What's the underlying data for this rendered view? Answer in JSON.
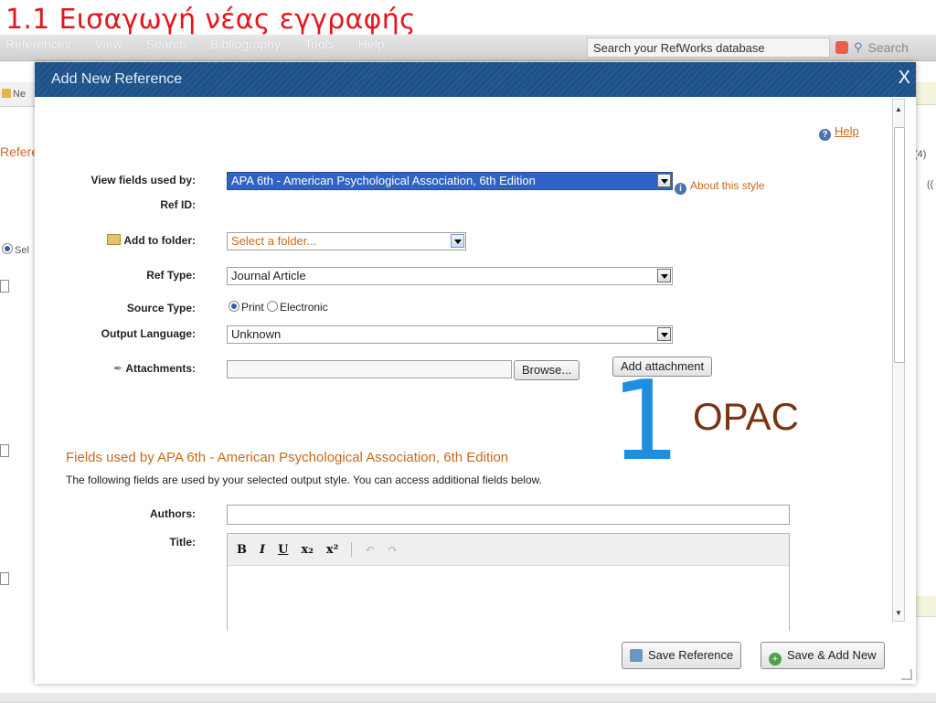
{
  "slide": {
    "title": "1.1 Εισαγωγή νέας εγγραφής"
  },
  "app": {
    "menu": [
      "References",
      "View",
      "Search",
      "Bibliography",
      "Tools",
      "Help"
    ],
    "search_placeholder": "Search your RefWorks database",
    "search_button": "Search",
    "new_button": "Ne",
    "left_label": "Refere",
    "select_label": "Sel",
    "right_count_a": "(4)",
    "right_count_b": "(("
  },
  "dialog": {
    "title": "Add New Reference",
    "close": "X",
    "help": "Help",
    "view_fields_label": "View fields used by:",
    "view_fields_value": "APA 6th - American Psychological Association, 6th Edition",
    "about_style": "About this style",
    "ref_id_label": "Ref ID:",
    "add_folder_label": "Add to folder:",
    "add_folder_value": "Select a folder...",
    "ref_type_label": "Ref Type:",
    "ref_type_value": "Journal Article",
    "source_type_label": "Source Type:",
    "source_print": "Print",
    "source_electronic": "Electronic",
    "output_lang_label": "Output Language:",
    "output_lang_value": "Unknown",
    "attachments_label": "Attachments:",
    "browse": "Browse...",
    "add_attachment": "Add attachment",
    "annotation_number": "1",
    "annotation_text": "OPAC",
    "section_title": "Fields used by APA 6th - American Psychological Association, 6th Edition",
    "section_sub": "The following fields are used by your selected output style. You can access additional fields below.",
    "authors_label": "Authors:",
    "title_label": "Title:",
    "toolbar": {
      "bold": "B",
      "italic": "I",
      "underline": "U",
      "sub": "x₂",
      "sup": "x²",
      "undo": "↶",
      "redo": "↷"
    },
    "save_reference": "Save Reference",
    "save_add_new": "Save & Add New"
  }
}
